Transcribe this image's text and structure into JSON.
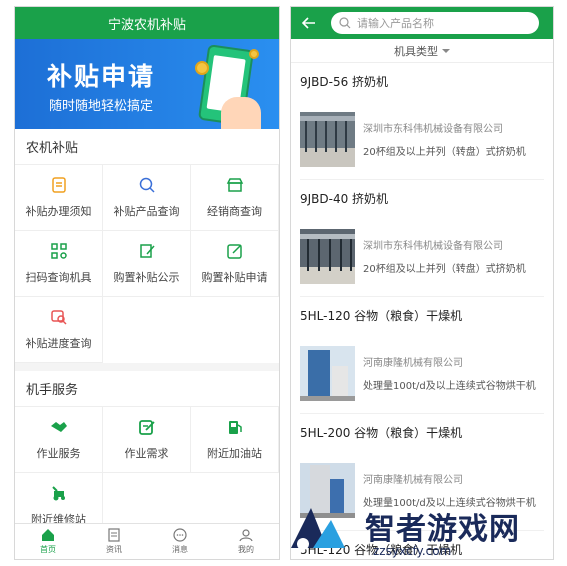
{
  "left": {
    "title": "宁波农机补贴",
    "banner": {
      "title": "补贴申请",
      "subtitle": "随时随地轻松搞定"
    },
    "section1": {
      "title": "农机补贴",
      "items": [
        {
          "label": "补贴办理须知",
          "icon": "notice-icon"
        },
        {
          "label": "补贴产品查询",
          "icon": "product-search-icon"
        },
        {
          "label": "经销商查询",
          "icon": "store-icon"
        },
        {
          "label": "扫码查询机具",
          "icon": "qr-code-icon"
        },
        {
          "label": "购置补贴公示",
          "icon": "publish-icon"
        },
        {
          "label": "购置补贴申请",
          "icon": "apply-edit-icon"
        },
        {
          "label": "补贴进度查询",
          "icon": "progress-search-icon"
        }
      ]
    },
    "section2": {
      "title": "机手服务",
      "items": [
        {
          "label": "作业服务",
          "icon": "handshake-icon"
        },
        {
          "label": "作业需求",
          "icon": "request-edit-icon"
        },
        {
          "label": "附近加油站",
          "icon": "gas-station-icon"
        },
        {
          "label": "附近维修站",
          "icon": "repair-icon"
        }
      ]
    },
    "tabs": [
      {
        "label": "首页",
        "icon": "home-icon",
        "active": true
      },
      {
        "label": "资讯",
        "icon": "news-icon",
        "active": false
      },
      {
        "label": "消息",
        "icon": "message-icon",
        "active": false
      },
      {
        "label": "我的",
        "icon": "user-icon",
        "active": false
      }
    ],
    "colors": {
      "accent": "#1aa14a",
      "banner": "#1d6fd6",
      "icon_green": "#1aa14a",
      "icon_orange": "#f0a020",
      "icon_red": "#e85555"
    }
  },
  "right": {
    "search_placeholder": "请输入产品名称",
    "filter_label": "机具类型",
    "products": [
      {
        "name": "9JBD-56 挤奶机",
        "company": "深圳市东科伟机械设备有限公司",
        "desc": "20杯组及以上并列（转盘）式挤奶机",
        "image": "milking-parlor"
      },
      {
        "name": "9JBD-40 挤奶机",
        "company": "深圳市东科伟机械设备有限公司",
        "desc": "20杯组及以上并列（转盘）式挤奶机",
        "image": "milking-parlor"
      },
      {
        "name": "5HL-120 谷物（粮食）干燥机",
        "company": "河南康隆机械有限公司",
        "desc": "处理量100t/d及以上连续式谷物烘干机",
        "image": "grain-dryer"
      },
      {
        "name": "5HL-200 谷物（粮食）干燥机",
        "company": "河南康隆机械有限公司",
        "desc": "处理量100t/d及以上连续式谷物烘干机",
        "image": "grain-dryer"
      },
      {
        "name": "5HL-120 谷物（粮食）干燥机",
        "company": "",
        "desc": "",
        "image": ""
      }
    ]
  },
  "watermark": {
    "text": "智者游戏网",
    "url": "zzsyxcfy.com"
  }
}
